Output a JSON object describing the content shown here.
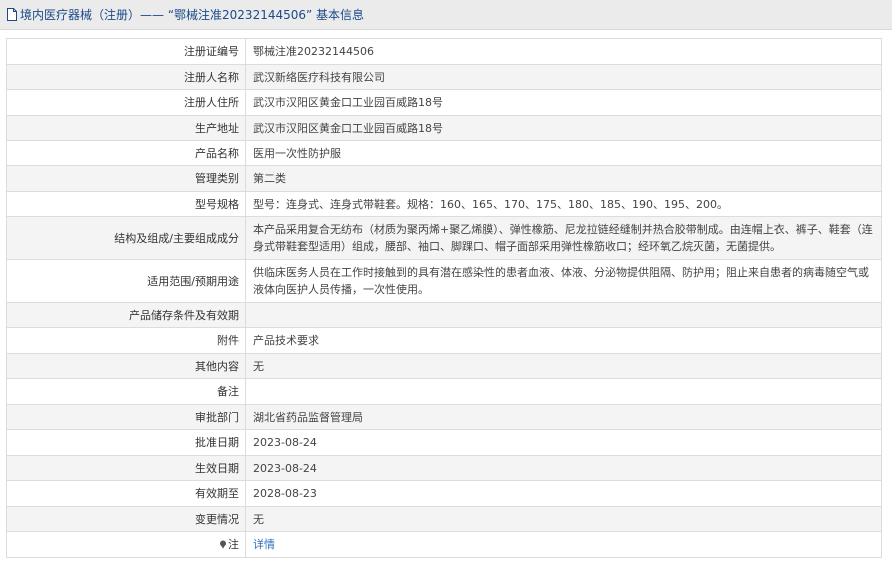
{
  "header": {
    "title": "境内医疗器械（注册）—— “鄂械注准20232144506” 基本信息",
    "icon": "document-icon"
  },
  "rows": [
    {
      "label": "注册证编号",
      "value": "鄂械注准20232144506"
    },
    {
      "label": "注册人名称",
      "value": "武汉新络医疗科技有限公司"
    },
    {
      "label": "注册人住所",
      "value": "武汉市汉阳区黄金口工业园百威路18号"
    },
    {
      "label": "生产地址",
      "value": "武汉市汉阳区黄金口工业园百威路18号"
    },
    {
      "label": "产品名称",
      "value": "医用一次性防护服"
    },
    {
      "label": "管理类别",
      "value": "第二类"
    },
    {
      "label": "型号规格",
      "value": "型号：连身式、连身式带鞋套。规格：160、165、170、175、180、185、190、195、200。"
    },
    {
      "label": "结构及组成/主要组成成分",
      "value": "本产品采用复合无纺布（材质为聚丙烯+聚乙烯膜）、弹性橡筋、尼龙拉链经缝制并热合胶带制成。由连帽上衣、裤子、鞋套（连身式带鞋套型适用）组成，腰部、袖口、脚踝口、帽子面部采用弹性橡筋收口；经环氧乙烷灭菌，无菌提供。"
    },
    {
      "label": "适用范围/预期用途",
      "value": "供临床医务人员在工作时接触到的具有潜在感染性的患者血液、体液、分泌物提供阻隔、防护用；阻止来自患者的病毒随空气或液体向医护人员传播，一次性使用。"
    },
    {
      "label": "产品储存条件及有效期",
      "value": ""
    },
    {
      "label": "附件",
      "value": "产品技术要求"
    },
    {
      "label": "其他内容",
      "value": "无"
    },
    {
      "label": "备注",
      "value": ""
    },
    {
      "label": "审批部门",
      "value": "湖北省药品监督管理局"
    },
    {
      "label": "批准日期",
      "value": "2023-08-24"
    },
    {
      "label": "生效日期",
      "value": "2023-08-24"
    },
    {
      "label": "有效期至",
      "value": "2028-08-23"
    },
    {
      "label": "变更情况",
      "value": "无"
    }
  ],
  "note_row": {
    "label": "注",
    "icon": "pin-icon",
    "link_text": "详情"
  },
  "colors": {
    "header_bg": "#ebebeb",
    "title_text": "#1a4a8a",
    "stripe": "#f4f4f4",
    "border": "#dcdcdc",
    "link": "#2a6ebb"
  }
}
